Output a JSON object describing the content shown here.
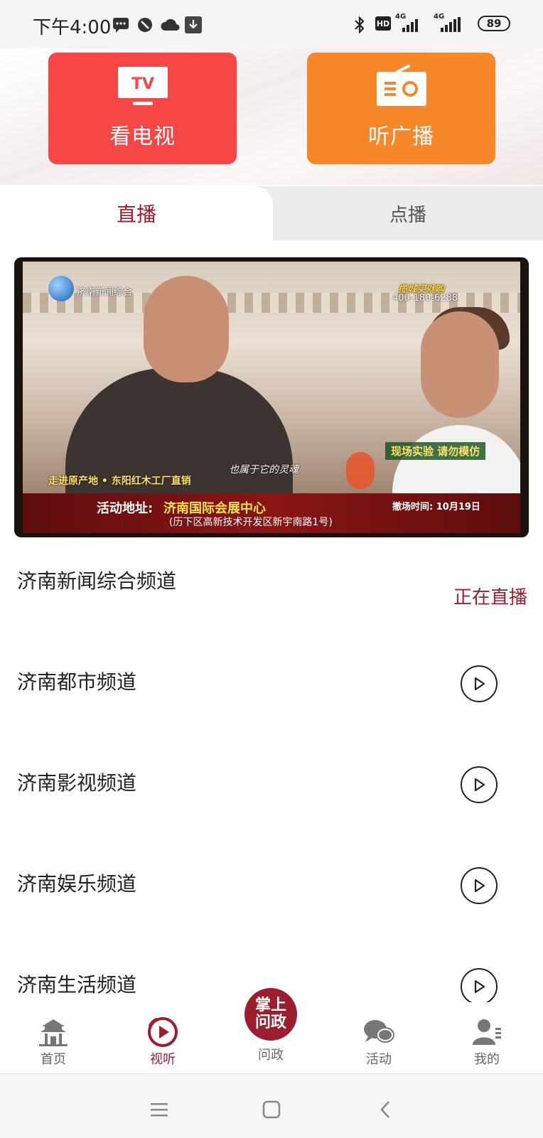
{
  "status_bar": {
    "time": "下午4:00",
    "network_1": "4G",
    "network_2": "4G",
    "hd": "HD",
    "battery": "89"
  },
  "hero": {
    "tv_icon_text": "TV",
    "tv_label": "看电视",
    "radio_label": "听广播"
  },
  "tabs": {
    "live": "直播",
    "vod": "点播"
  },
  "player": {
    "channel_logo_text": "济南新闻综合",
    "brand": "揽城买就购",
    "hotline": "400-180-6288",
    "caption_right": "现场实验 请勿模仿",
    "sub_quote": "也属于它的灵魂",
    "caption_left": "走进原产地 • 东阳红木工厂直销",
    "address_label": "活动地址:",
    "address_venue": "济南国际会展中心",
    "address_detail": "(历下区高新技术开发区新宇南路1号)",
    "close_time": "撤场时间: 10月19日"
  },
  "channels": [
    {
      "name": "济南新闻综合频道",
      "status": "正在直播"
    },
    {
      "name": "济南都市频道"
    },
    {
      "name": "济南影视频道"
    },
    {
      "name": "济南娱乐频道"
    },
    {
      "name": "济南生活频道"
    }
  ],
  "tabbar": {
    "home": "首页",
    "watch": "视听",
    "center_line1": "掌上",
    "center_line2": "问政",
    "center_label": "问政",
    "activity": "活动",
    "mine": "我的",
    "active_color": "#9a1e2e"
  }
}
